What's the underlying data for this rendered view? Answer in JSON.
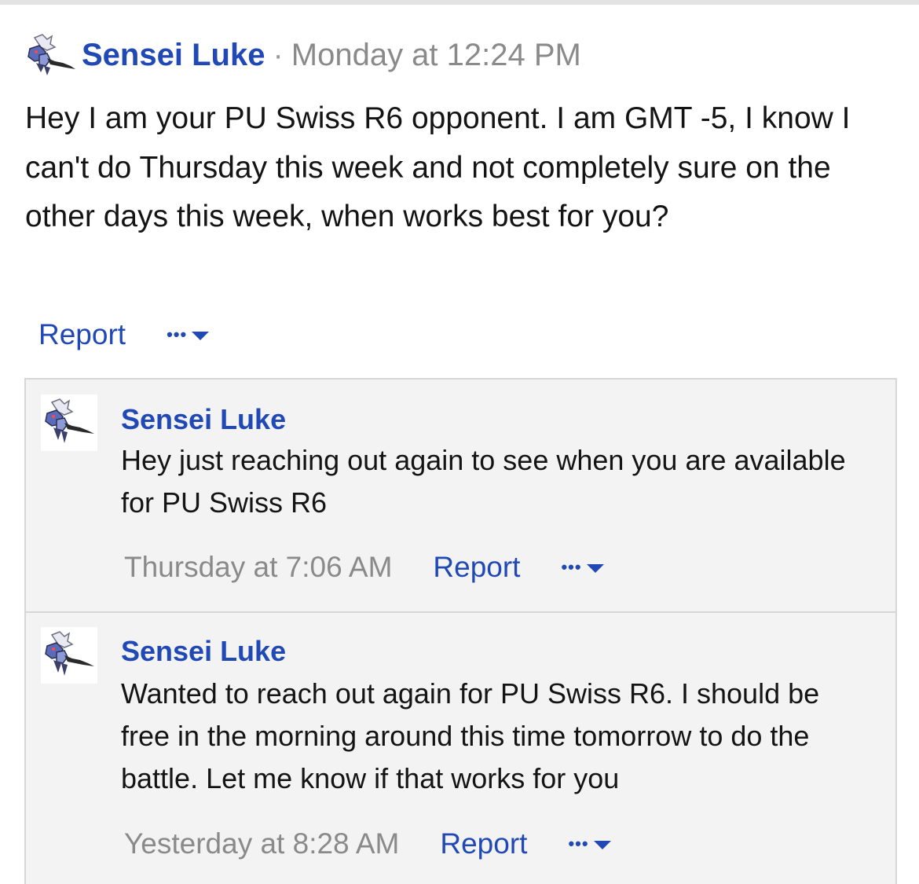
{
  "post": {
    "author": "Sensei Luke",
    "separator": "·",
    "time": "Monday at 12:24 PM",
    "body": "Hey I am your PU Swiss R6 opponent. I am GMT -5, I know I can't do Thursday this week and not completely sure on the other days this week, when works best for you?",
    "report_label": "Report",
    "more_label": "•••"
  },
  "comments": [
    {
      "author": "Sensei Luke",
      "text": "Hey just reaching out again to see when you are available for PU Swiss R6",
      "time": "Thursday at 7:06 AM",
      "report_label": "Report",
      "more_label": "•••"
    },
    {
      "author": "Sensei Luke",
      "text": "Wanted to reach out again for PU Swiss R6. I should be free in the morning around this time tomorrow to do the battle. Let me know if that works for you",
      "time": "Yesterday at 8:28 AM",
      "report_label": "Report",
      "more_label": "•••"
    }
  ],
  "colors": {
    "link": "#2149b6",
    "muted": "#8a8a8a",
    "text": "#141414",
    "comment_bg": "#f3f3f3",
    "border": "#d6d6d6"
  }
}
